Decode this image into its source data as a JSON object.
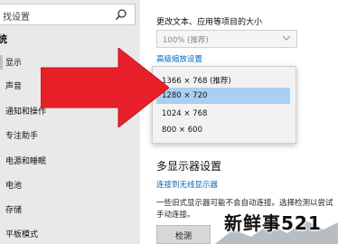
{
  "sidebar": {
    "search_placeholder": "找设置",
    "section_title": "统",
    "items": [
      {
        "label": "显示",
        "active": true
      },
      {
        "label": "声音"
      },
      {
        "label": "通知和操作"
      },
      {
        "label": "专注助手"
      },
      {
        "label": "电源和睡眠"
      },
      {
        "label": "电池"
      },
      {
        "label": "存储"
      },
      {
        "label": "平板模式"
      }
    ]
  },
  "main": {
    "scale_label": "更改文本、应用等项目的大小",
    "scale_value": "100% (推荐)",
    "advanced_scaling_link": "高级缩放设置",
    "resolution_options": [
      {
        "label": "1366 × 768 (推荐)",
        "selected": false
      },
      {
        "label": "1280 × 720",
        "selected": true
      },
      {
        "label": "1024 × 768",
        "selected": false
      },
      {
        "label": "800 × 600",
        "selected": false
      }
    ],
    "multi_display_title": "多显示器设置",
    "wireless_link": "连接到无线显示器",
    "description": "一些旧式显示器可能不会自动连接。选择检测以尝试手动连接。",
    "detect_button": "检测"
  },
  "watermark": {
    "text": "新鲜事521"
  },
  "colors": {
    "accent_link": "#0067b8",
    "selected_option": "#a9d0f2",
    "arrow_red": "#e8202a",
    "sidebar_bg": "#e9e9e9"
  }
}
